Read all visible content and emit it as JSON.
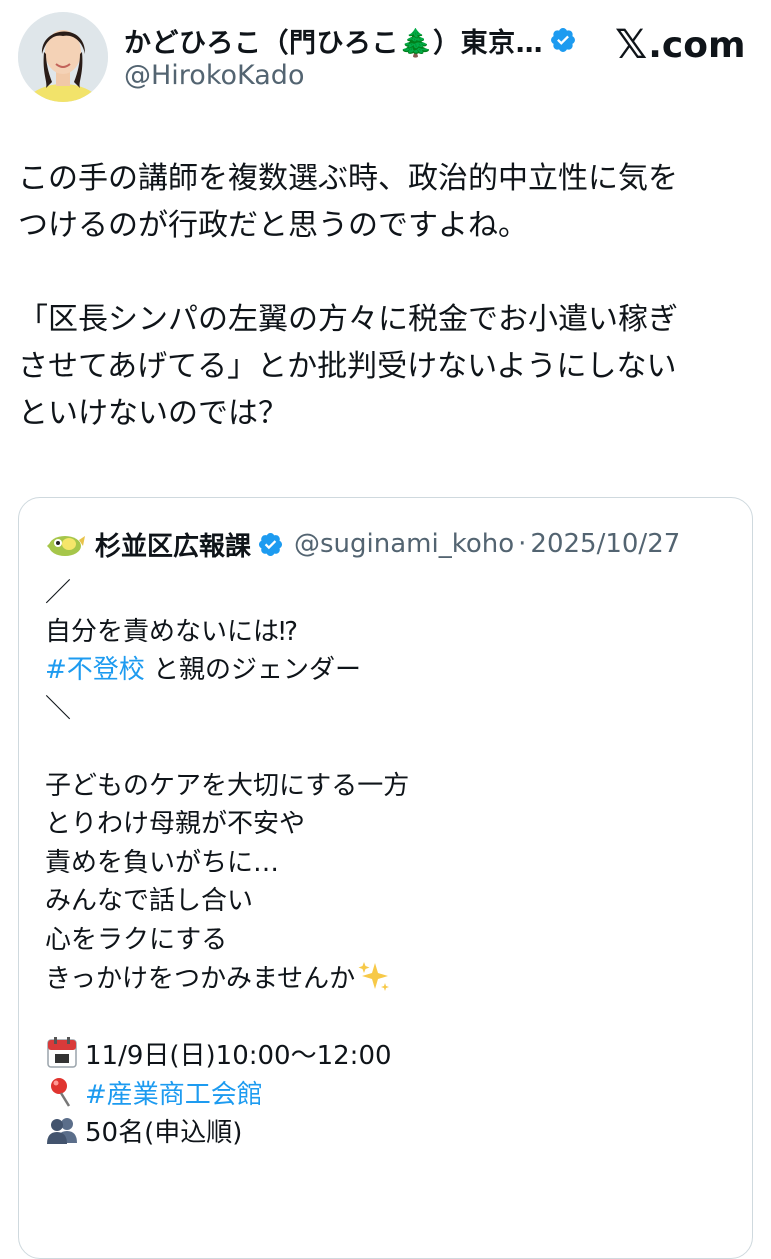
{
  "author": {
    "display_name": "かどひろこ（門ひろこ🌲）東京…",
    "handle": "@HirokoKado"
  },
  "brand": {
    "logo_x": "𝕏",
    "logo_text": ".com"
  },
  "tweet": {
    "text_lines": [
      "この手の講師を複数選ぶ時、政治的中立性に気を",
      "つけるのが行政だと思うのですよね。",
      "",
      "「区長シンパの左翼の方々に税金でお小遣い稼ぎ",
      "させてあげてる」とか批判受けないようにしない",
      "といけないのでは？"
    ]
  },
  "quote": {
    "name": "杉並区広報課",
    "handle": "@suginami_koho",
    "separator": "·",
    "date": "2025/10/27",
    "lines": {
      "l1": "／",
      "l2": "自分を責めないには⁉︎",
      "l3_tag": "#不登校",
      "l3_rest": " と親のジェンダー",
      "l4": "＼",
      "l5": "子どものケアを大切にする一方",
      "l6": "とりわけ母親が不安や",
      "l7": "責めを負いがちに…",
      "l8": "みんなで話し合い",
      "l9": "心をラクにする",
      "l10": "きっかけをつかみませんか",
      "l11": "11/9日(日)10:00〜12:00",
      "l12_tag": "#産業商工会館",
      "l13": "50名(申込順)"
    },
    "icons": {
      "sparkles": "sparkles-icon",
      "calendar": "calendar-icon",
      "pin": "location-pin-icon",
      "people": "people-icon"
    }
  },
  "colors": {
    "link": "#1d9bf0",
    "secondary_text": "#536471",
    "verified": "#1d9bf0",
    "border": "#cfd9de"
  }
}
